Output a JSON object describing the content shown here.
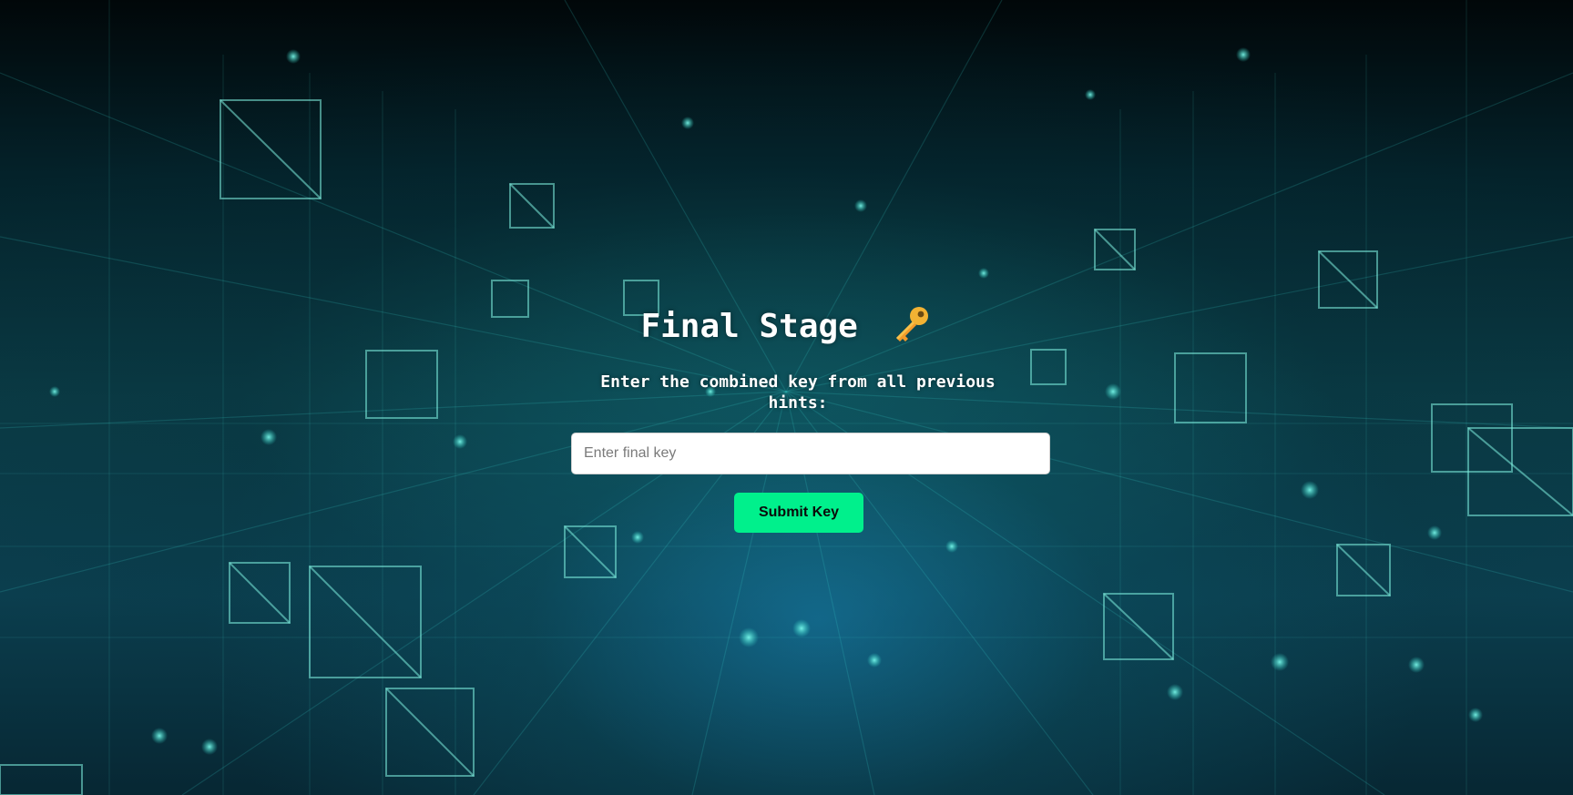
{
  "page": {
    "title": "Final Stage",
    "title_icon": "key-icon",
    "instruction": "Enter the combined key from all previous hints:"
  },
  "form": {
    "input_placeholder": "Enter final key",
    "input_value": "",
    "submit_label": "Submit Key"
  },
  "colors": {
    "accent": "#00f08c",
    "text": "#ffffff",
    "background": "#0a3a44"
  }
}
